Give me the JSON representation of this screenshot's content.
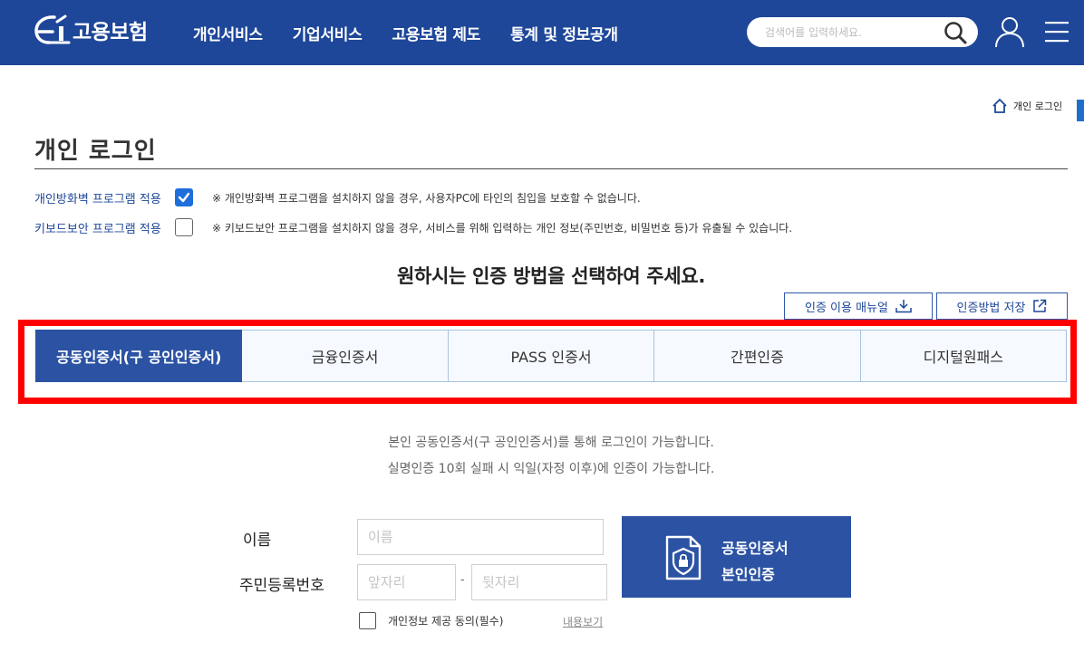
{
  "header": {
    "logo_text": "고용보험",
    "nav": [
      "개인서비스",
      "기업서비스",
      "고용보험 제도",
      "통계 및 정보공개"
    ],
    "search_placeholder": "검색어를 입력하세요."
  },
  "breadcrumb": {
    "label": "개인 로그인"
  },
  "page": {
    "title": "개인 로그인",
    "options": [
      {
        "label": "개인방화벽 프로그램 적용",
        "checked": true,
        "note": "※ 개인방화벽 프로그램을 설치하지 않을 경우, 사용자PC에 타인의 침입을 보호할 수 없습니다."
      },
      {
        "label": "키보드보안 프로그램 적용",
        "checked": false,
        "note": "※ 키보드보안 프로그램을 설치하지 않을 경우, 서비스를 위해 입력하는 개인 정보(주민번호, 비밀번호 등)가 유출될 수 있습니다."
      }
    ],
    "headline": "원하시는 인증 방법을 선택하여 주세요.",
    "manual_btn": "인증 이용 매뉴얼",
    "save_btn": "인증방법 저장"
  },
  "tabs": [
    {
      "label": "공동인증서(구 공인인증서)",
      "active": true
    },
    {
      "label": "금융인증서",
      "active": false
    },
    {
      "label": "PASS 인증서",
      "active": false
    },
    {
      "label": "간편인증",
      "active": false
    },
    {
      "label": "디지털원패스",
      "active": false
    }
  ],
  "info": [
    "본인 공동인증서(구 공인인증서)를 통해 로그인이 가능합니다.",
    "실명인증 10회 실패 시 익일(자정 이후)에 인증이 가능합니다."
  ],
  "form": {
    "name_label": "이름",
    "name_placeholder": "이름",
    "rrn_label": "주민등록번호",
    "rrn_front_placeholder": "앞자리",
    "rrn_back_placeholder": "뒷자리",
    "dash": "-",
    "cert_btn_line1": "공동인증서",
    "cert_btn_line2": "본인인증",
    "agree_label": "개인정보 제공 동의(필수)",
    "view_link": "내용보기"
  },
  "colors": {
    "brand": "#1e4799",
    "tab_active": "#2b52a3",
    "highlight_frame": "#ff0000",
    "checkbox_checked": "#1e6fdc"
  }
}
